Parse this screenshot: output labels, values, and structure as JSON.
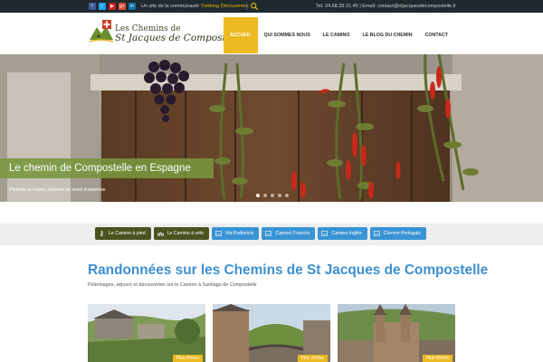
{
  "topbar": {
    "community_prefix": "Un site de la communauté",
    "community_link": "Trekking Découvertes",
    "contact": "Tel. 04.68.39.21.45 | Email: contact@stjacquesdecompostelle.fr",
    "social_icons": [
      "facebook-icon",
      "twitter-icon",
      "youtube-icon",
      "google-plus-icon",
      "linkedin-icon"
    ],
    "social_glyphs": [
      "f",
      "t",
      "▶",
      "g+",
      "in"
    ]
  },
  "logo": {
    "line1": "Les Chemins de",
    "line2": "St Jacques de Compostelle"
  },
  "nav": {
    "items": [
      "ACCUEIL",
      "QUI SOMMES NOUS",
      "LE CAMINO",
      "LE BLOG DU CHEMIN",
      "CONTACT"
    ],
    "active_index": 0
  },
  "hero": {
    "caption": "Le chemin de Compostelle en Espagne",
    "subcaption": "Piments et raisins séchent au soleil d'automne",
    "slide_count": 5,
    "active_slide": 0
  },
  "categories": [
    {
      "label": "Le Camino à pied",
      "icon": "walker-icon",
      "style": "dark"
    },
    {
      "label": "Le Camino à vélo",
      "icon": "bicycle-icon",
      "style": "dark"
    },
    {
      "label": "Via Podiensis",
      "icon": "image-icon",
      "style": "blue"
    },
    {
      "label": "Camino Francés",
      "icon": "image-icon",
      "style": "blue"
    },
    {
      "label": "Camino Inglés",
      "icon": "image-icon",
      "style": "blue"
    },
    {
      "label": "Chemin Portugais",
      "icon": "image-icon",
      "style": "blue"
    }
  ],
  "main": {
    "title": "Randonnées sur les Chemins de St Jacques de Compostelle",
    "subtitle": "Pélerinages, séjours et découvertes sur le Camino à Santiago de Compostelle"
  },
  "thumbnails": [
    {
      "badge": "Plus d'infos"
    },
    {
      "badge": "Plus d'infos"
    },
    {
      "badge": "Plus d'infos"
    }
  ],
  "colors": {
    "accent_yellow": "#ecb920",
    "link_blue": "#3d8fd0",
    "topbar_bg": "#1f2a2e",
    "caption_green": "#789639",
    "category_dark": "#4b5321",
    "category_blue": "#3a93d5"
  }
}
